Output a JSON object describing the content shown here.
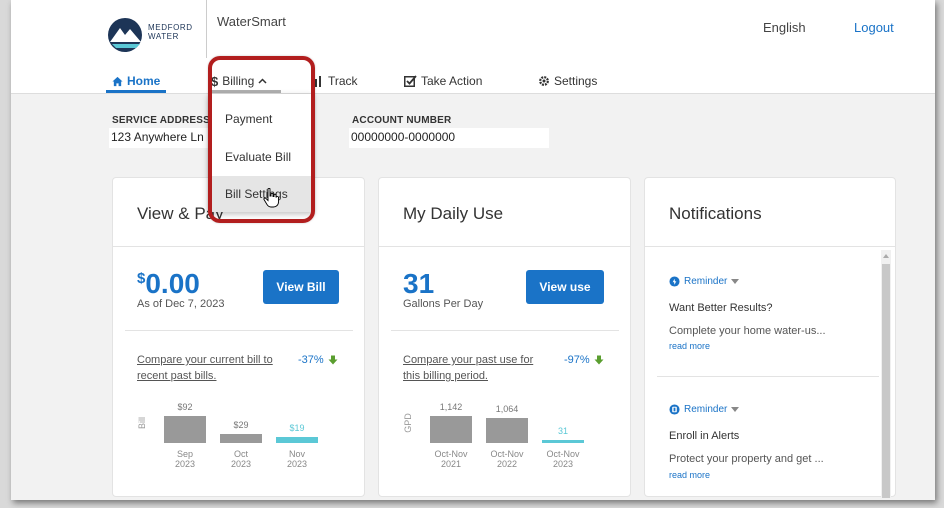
{
  "header": {
    "logo_text": "MEDFORD WATER",
    "app_name": "WaterSmart",
    "language": "English",
    "logout": "Logout"
  },
  "nav": {
    "home": "Home",
    "billing": "Billing",
    "track": "Track",
    "take_action": "Take Action",
    "settings": "Settings"
  },
  "billing_menu": {
    "items": [
      "Payment",
      "Evaluate Bill",
      "Bill Settings"
    ]
  },
  "account": {
    "service_address_label": "SERVICE ADDRESS",
    "service_address_value": "123 Anywhere Ln",
    "account_number_label": "ACCOUNT NUMBER",
    "account_number_value": "00000000-0000000"
  },
  "view_bill_card": {
    "title": "View & Pay",
    "currency": "$",
    "amount": "0.00",
    "as_of": "As of Dec 7, 2023",
    "button": "View Bill",
    "compare_text": "Compare your current bill to recent past bills.",
    "change": "-37%",
    "y_label": "Bill"
  },
  "daily_use_card": {
    "title": "My Daily Use",
    "value": "31",
    "unit": "Gallons Per Day",
    "button": "View use",
    "compare_text": "Compare your past use for this billing period.",
    "change": "-97%",
    "y_label": "GPD"
  },
  "notifications_card": {
    "title": "Notifications",
    "items": [
      {
        "tag": "Reminder",
        "title": "Want Better Results?",
        "body": "Complete your home water-us...",
        "more": "read more"
      },
      {
        "tag": "Reminder",
        "title": "Enroll in Alerts",
        "body": "Protect your property and get ...",
        "more": "read more"
      }
    ]
  },
  "colors": {
    "accent": "#1a73c7",
    "bar_past": "#999999",
    "bar_current": "#5bc8d6",
    "highlight": "#b21e1e",
    "trend_green": "#5a9e2f"
  },
  "chart_data": [
    {
      "type": "bar",
      "categories": [
        "Sep 2023",
        "Oct 2023",
        "Nov 2023"
      ],
      "values": [
        92,
        29,
        19
      ],
      "labels": [
        "$92",
        "$29",
        "$19"
      ],
      "ylabel": "Bill"
    },
    {
      "type": "bar",
      "categories": [
        "Oct-Nov 2021",
        "Oct-Nov 2022",
        "Oct-Nov 2023"
      ],
      "values": [
        1142,
        1064,
        31
      ],
      "labels": [
        "1,142",
        "1,064",
        "31"
      ],
      "ylabel": "GPD"
    }
  ]
}
